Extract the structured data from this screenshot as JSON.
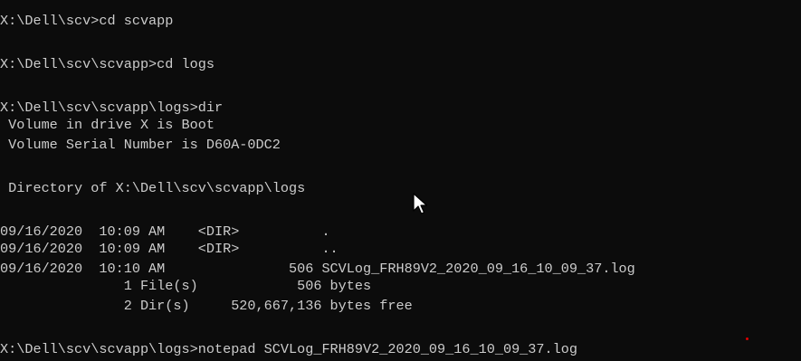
{
  "console": {
    "lines": [
      "X:\\Dell\\scv>cd scvapp",
      "X:\\Dell\\scv\\scvapp>cd logs",
      "X:\\Dell\\scv\\scvapp\\logs>dir",
      " Volume in drive X is Boot",
      " Volume Serial Number is D60A-0DC2",
      " Directory of X:\\Dell\\scv\\scvapp\\logs",
      "09/16/2020  10:09 AM    <DIR>          .",
      "09/16/2020  10:09 AM    <DIR>          ..",
      "09/16/2020  10:10 AM               506 SCVLog_FRH89V2_2020_09_16_10_09_37.log",
      "               1 File(s)            506 bytes",
      "               2 Dir(s)     520,667,136 bytes free",
      "X:\\Dell\\scv\\scvapp\\logs>notepad SCVLog_FRH89V2_2020_09_16_10_09_37.log"
    ]
  },
  "colors": {
    "background": "#0c0c0c",
    "text": "#cccccc",
    "mouse_cursor": "#ffffff",
    "red_marker": "#e00000"
  },
  "icons": {
    "mouse_cursor": "arrow-pointer-icon"
  }
}
